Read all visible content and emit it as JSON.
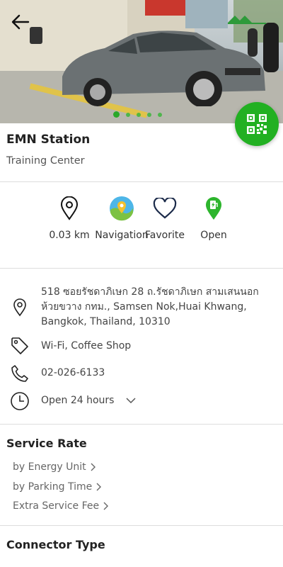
{
  "station": {
    "name": "EMN Station",
    "location_name": "Training Center"
  },
  "actions": [
    {
      "label": "0.03 km",
      "icon": "location-pin-icon"
    },
    {
      "label": "Navigation",
      "icon": "map-navigation-icon"
    },
    {
      "label": "Favorite",
      "icon": "heart-icon"
    },
    {
      "label": "Open",
      "icon": "charging-station-icon"
    }
  ],
  "info": {
    "address": "518 ซอยรัชดาภิเษก 28 ถ.รัชดาภิเษก สามเสนนอก ห้วยขวาง กทม., Samsen Nok,Huai Khwang, Bangkok, Thailand, 10310",
    "amenities": "Wi-Fi, Coffee Shop",
    "phone": "02-026-6133",
    "hours": "Open 24 hours"
  },
  "service_rate": {
    "title": "Service Rate",
    "links": [
      "by Energy Unit",
      "by Parking Time",
      "Extra Service Fee"
    ]
  },
  "connector": {
    "title": "Connector Type"
  },
  "carousel": {
    "count": 5,
    "active": 0
  },
  "colors": {
    "accent": "#22b022",
    "text": "#222222",
    "muted": "#666666"
  }
}
